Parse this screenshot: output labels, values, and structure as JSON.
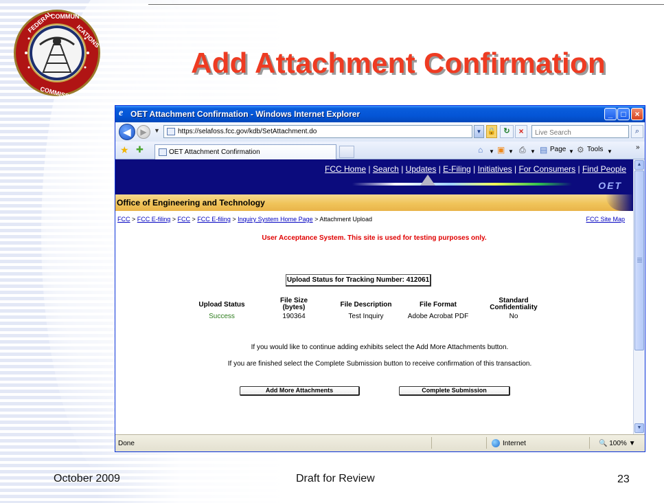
{
  "slide": {
    "title": "Add Attachment Confirmation",
    "footer_left": "October 2009",
    "footer_center": "Draft for Review",
    "page_number": "23",
    "title_color": "#ee3b22"
  },
  "browser": {
    "window_title": "OET Attachment Confirmation - Windows Internet Explorer",
    "address_url": "https://selafoss.fcc.gov/kdb/SetAttachment.do",
    "search_placeholder": "Live Search",
    "tab_label": "OET Attachment Confirmation",
    "toolbar_page": "Page",
    "toolbar_tools": "Tools",
    "status_left": "Done",
    "status_zone": "Internet",
    "status_zoom": "100%"
  },
  "page": {
    "top_links": [
      "FCC Home",
      "Search",
      "Updates",
      "E-Filing",
      "Initiatives",
      "For Consumers",
      "Find People"
    ],
    "banner_logo_text": "OET",
    "office_label": "Office of Engineering and Technology",
    "breadcrumbs": [
      "FCC",
      "FCC E-filing",
      "FCC",
      "FCC E-filing",
      "Inquiry System Home Page"
    ],
    "breadcrumb_current": "Attachment Upload",
    "site_map": "FCC Site Map",
    "uat_notice": "User Acceptance System. This site is used for testing purposes only.",
    "upload_status_heading": "Upload Status for Tracking Number: 412061",
    "table": {
      "headers": [
        "Upload Status",
        "File Size (bytes)",
        "File Description",
        "File Format",
        "Standard Confidentiality"
      ],
      "row": [
        "Success",
        "190364",
        "Test Inquiry",
        "Adobe Acrobat PDF",
        "No"
      ]
    },
    "message_line1": "If you would like to continue adding exhibits select the Add More Attachments button.",
    "message_line2": "If you are finished select the Complete Submission button to receive confirmation of this transaction.",
    "btn_add_more": "Add More Attachments",
    "btn_complete": "Complete Submission"
  }
}
